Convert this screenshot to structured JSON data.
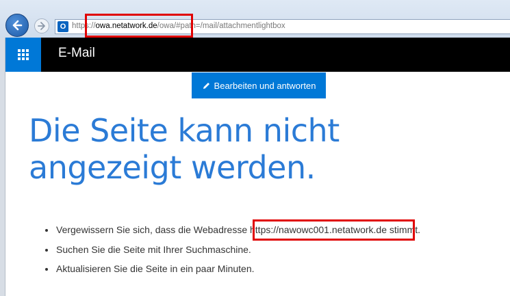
{
  "browser": {
    "url_prefix": "https://",
    "url_domain": "owa.netatwork.de",
    "url_path": "/owa/#path=/mail/attachmentlightbox",
    "site_icon": "O"
  },
  "header": {
    "app_title": "E-Mail"
  },
  "toolbar": {
    "edit_reply_label": "Bearbeiten und antworten"
  },
  "error": {
    "title": "Die Seite kann nicht angezeigt werden.",
    "tips": [
      {
        "before": "Vergewissern Sie sich, dass die Webadresse ",
        "link": "https://nawowc001.netatwork.de",
        "after": " stimmt."
      },
      {
        "text": "Suchen Sie die Seite mit Ihrer Suchmaschine."
      },
      {
        "text": "Aktualisieren Sie die Seite in ein paar Minuten."
      }
    ]
  },
  "colors": {
    "accent": "#0078d7",
    "title_blue": "#2b7bd6",
    "highlight_red": "#e00000",
    "header_black": "#000000"
  }
}
